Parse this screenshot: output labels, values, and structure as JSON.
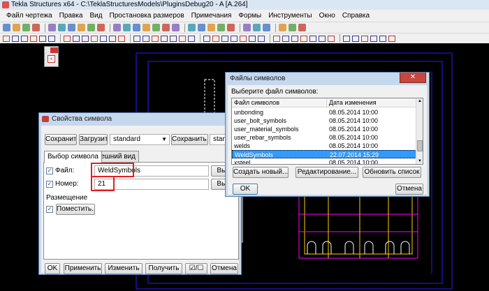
{
  "window": {
    "title": "Tekla Structures x64 - C:\\TeklaStructuresModels\\PluginsDebug20 - A   [A.264]"
  },
  "menu": [
    "Файл чертежа",
    "Правка",
    "Вид",
    "Простановка размеров",
    "Примечания",
    "Формы",
    "Инструменты",
    "Окно",
    "Справка"
  ],
  "colors": {
    "accent": "#c9463d",
    "selection": "#3399ff",
    "drawing_lines": "#2020ff",
    "drawing_parts": "#ff00ff",
    "drawing_edges": "#ffd000"
  },
  "symbol_props": {
    "title": "Свойства символа",
    "save": "Сохранить",
    "load": "Загрузить",
    "preset": "standard",
    "save_as": "Сохранить как",
    "save_as_value": "standard",
    "tabs": [
      "Выбор символа",
      "Внешний вид"
    ],
    "file_label": "Файл:",
    "file_value": "WeldSymbols",
    "browse_label": "Выбр",
    "number_label": "Номер:",
    "number_value": "21",
    "placement_label": "Размещение",
    "place_button": "Поместить...",
    "ok": "OK",
    "apply": "Применить",
    "modify": "Изменить",
    "get": "Получить",
    "toggle": "☑/☐",
    "cancel": "Отмена"
  },
  "symbol_files": {
    "title": "Файлы символов",
    "prompt": "Выберите файл символов:",
    "col_name": "Файл символов",
    "col_date": "Дата изменения",
    "rows": [
      {
        "name": "unbonding",
        "date": "08.05.2014 10:00"
      },
      {
        "name": "user_bolt_symbols",
        "date": "08.05.2014 10:00"
      },
      {
        "name": "user_material_symbols",
        "date": "08.05.2014 10:00"
      },
      {
        "name": "user_rebar_symbols",
        "date": "08.05.2014 10:00"
      },
      {
        "name": "welds",
        "date": "08.05.2014 10:00"
      },
      {
        "name": "WeldSymbols",
        "date": "22.07.2014 15:29",
        "selected": true
      },
      {
        "name": "xsteel",
        "date": "08.05.2014 10:00"
      }
    ],
    "create": "Создать новый...",
    "edit": "Редактирование...",
    "refresh": "Обновить список",
    "ok": "OK",
    "cancel": "Отмена"
  }
}
